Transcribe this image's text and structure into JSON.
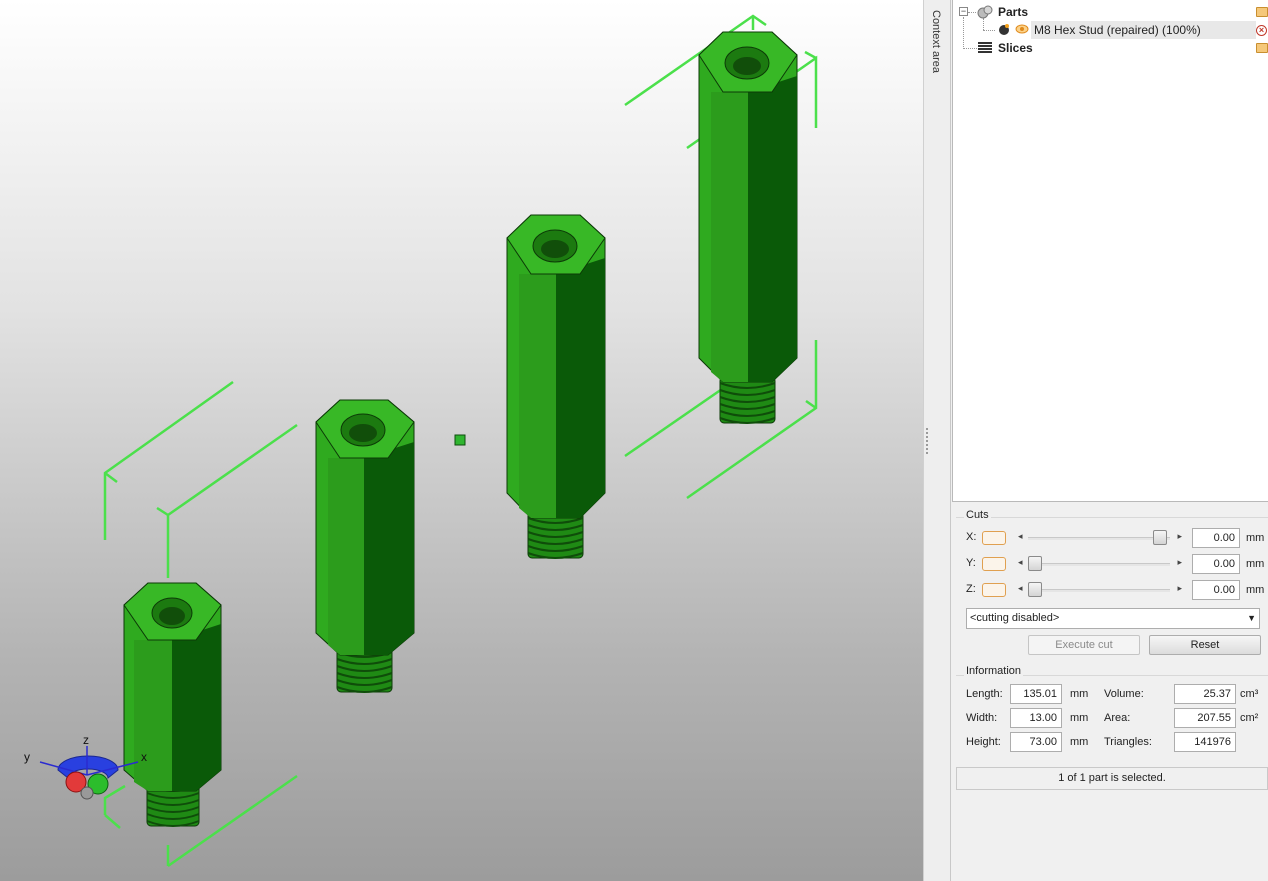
{
  "context_strip": {
    "label": "Context area"
  },
  "tree": {
    "parts": {
      "label": "Parts",
      "expander": "−"
    },
    "part_item": {
      "label": "M8 Hex Stud (repaired) (100%)"
    },
    "slices": {
      "label": "Slices"
    }
  },
  "cuts": {
    "title": "Cuts",
    "x": {
      "label": "X:",
      "value": "0.00",
      "unit": "mm",
      "slider_fraction": 0.98
    },
    "y": {
      "label": "Y:",
      "value": "0.00",
      "unit": "mm",
      "slider_fraction": 0.0
    },
    "z": {
      "label": "Z:",
      "value": "0.00",
      "unit": "mm",
      "slider_fraction": 0.0
    },
    "mode_select": "<cutting disabled>",
    "execute_label": "Execute cut",
    "reset_label": "Reset"
  },
  "information": {
    "title": "Information",
    "length": {
      "label": "Length:",
      "value": "135.01",
      "unit": "mm"
    },
    "width": {
      "label": "Width:",
      "value": "13.00",
      "unit": "mm"
    },
    "height": {
      "label": "Height:",
      "value": "73.00",
      "unit": "mm"
    },
    "volume": {
      "label": "Volume:",
      "value": "25.37",
      "unit": "cm³"
    },
    "area": {
      "label": "Area:",
      "value": "207.55",
      "unit": "cm²"
    },
    "triangles": {
      "label": "Triangles:",
      "value": "141976"
    }
  },
  "status": "1 of 1 part is selected.",
  "axes": {
    "x": "x",
    "y": "y",
    "z": "z"
  },
  "colors": {
    "part_green": "#2faa1f",
    "bbox_green": "#4be04b",
    "cut_toggle": "#e0a050"
  }
}
